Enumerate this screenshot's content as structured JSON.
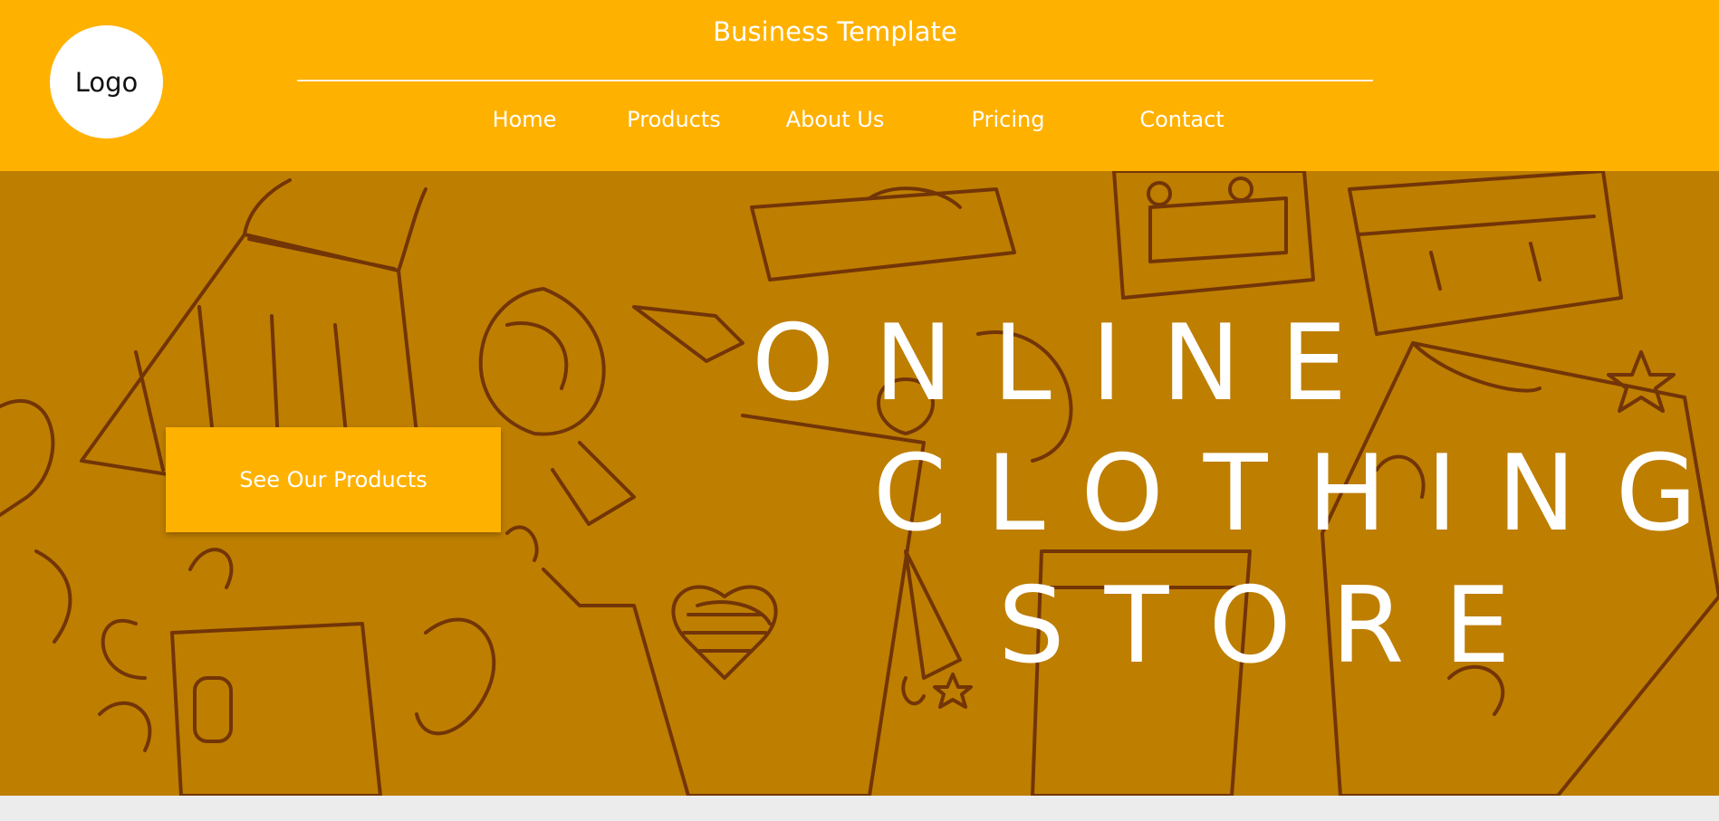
{
  "header": {
    "logo_text": "Logo",
    "site_title": "Business Template",
    "nav": [
      "Home",
      "Products",
      "About Us",
      "Pricing",
      "Contact"
    ]
  },
  "hero": {
    "cta_label": "See Our Products",
    "headline_lines": [
      "ONLINE",
      "CLOTHING",
      "STORE"
    ]
  },
  "colors": {
    "brand": "#ffb100",
    "hero_overlay": "#be7e00",
    "line_art": "#6a2e08",
    "text": "#ffffff"
  }
}
